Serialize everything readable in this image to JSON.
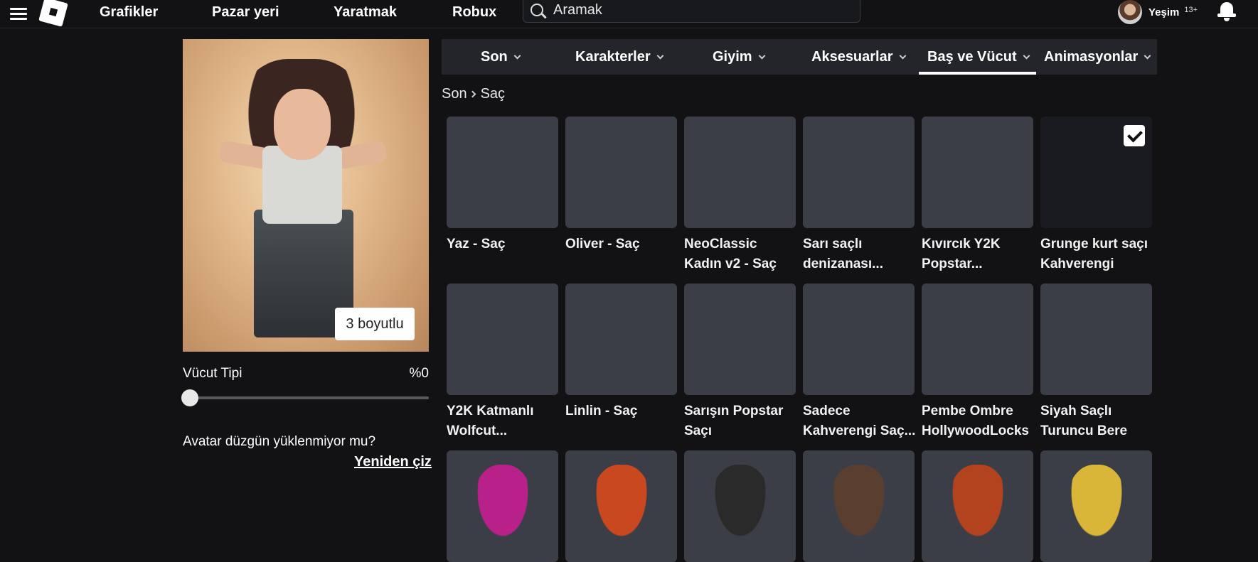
{
  "topnav": {
    "links": [
      "Grafikler",
      "Pazar yeri",
      "Yaratmak",
      "Robux"
    ],
    "search_placeholder": "Aramak",
    "username": "Yeşim",
    "age_badge": "13+"
  },
  "preview": {
    "toggle_3d_label": "3 boyutlu",
    "body_type_label": "Vücut Tipi",
    "body_type_value": "%0",
    "body_type_level": 0,
    "redraw_question": "Avatar düzgün yüklenmiyor mu?",
    "redraw_link": "Yeniden çiz"
  },
  "tabs": [
    {
      "label": "Son",
      "active": false
    },
    {
      "label": "Karakterler",
      "active": false
    },
    {
      "label": "Giyim",
      "active": false
    },
    {
      "label": "Aksesuarlar",
      "active": false
    },
    {
      "label": "Baş ve Vücut",
      "active": true
    },
    {
      "label": "Animasyonlar",
      "active": false
    }
  ],
  "breadcrumb": [
    "Son",
    "Saç"
  ],
  "items": [
    {
      "line1": "Yaz - Saç",
      "line2": "",
      "color": "#6b5138",
      "selected": false
    },
    {
      "line1": "Oliver - Saç",
      "line2": "",
      "color": "#8a7257",
      "selected": false
    },
    {
      "line1": "NeoClassic",
      "line2": "Kadın v2 - Saç",
      "color": "#1c1a1c",
      "selected": false
    },
    {
      "line1": "Sarı saçlı",
      "line2": "denizanası...",
      "color": "#e8c7a4",
      "selected": false
    },
    {
      "line1": "Kıvırcık Y2K",
      "line2": "Popstar...",
      "color": "#efcba0",
      "selected": false
    },
    {
      "line1": "Grunge kurt saçı",
      "line2": "Kahverengi",
      "color": "#2a1f1c",
      "selected": true
    },
    {
      "line1": "Y2K Katmanlı",
      "line2": "Wolfcut...",
      "color": "#6d4c3a",
      "selected": false
    },
    {
      "line1": "Linlin - Saç",
      "line2": "",
      "color": "#d9ab85",
      "selected": false
    },
    {
      "line1": "Sarışın Popstar",
      "line2": "Saçı",
      "color": "#e6c8a0",
      "selected": false
    },
    {
      "line1": "Sadece",
      "line2": "Kahverengi Saç...",
      "color": "#8a6a52",
      "selected": false
    },
    {
      "line1": "Pembe Ombre",
      "line2": "HollywoodLocks",
      "color": "#e38aa0",
      "selected": false
    },
    {
      "line1": "Siyah Saçlı",
      "line2": "Turuncu Bere",
      "color": "#c4552a",
      "selected": false
    }
  ],
  "partial_row_colors": [
    "#b8218a",
    "#c9481f",
    "#2a2a2a",
    "#5a3e30",
    "#b3421f",
    "#d9b638"
  ]
}
